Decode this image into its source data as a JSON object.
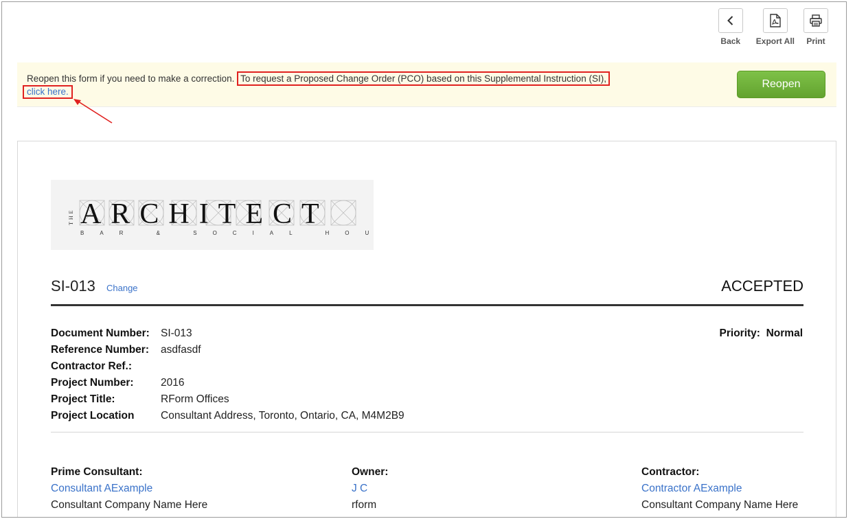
{
  "toolbar": {
    "back_label": "Back",
    "export_label": "Export All",
    "print_label": "Print"
  },
  "notice": {
    "text_part1": "Reopen this form if you need to make a correction.",
    "text_part2": "To request a Proposed Change Order (PCO) based on this Supplemental Instruction (SI),",
    "link_text": "click here.",
    "reopen_label": "Reopen",
    "annotation_color": "#e0211f",
    "reopen_color": "#6cb23a"
  },
  "document": {
    "logo": {
      "text": "ARCHITECT",
      "prefix": "THE",
      "subtitle": "BAR & SOCIAL HOUSE"
    },
    "id": "SI-013",
    "change_label": "Change",
    "status": "ACCEPTED",
    "priority_label": "Priority:",
    "priority_value": "Normal",
    "fields": [
      {
        "label": "Document Number:",
        "value": "SI-013"
      },
      {
        "label": "Reference Number:",
        "value": "asdfasdf"
      },
      {
        "label": "Contractor Ref.:",
        "value": ""
      },
      {
        "label": "Project Number:",
        "value": "2016"
      },
      {
        "label": "Project Title:",
        "value": "RForm Offices"
      },
      {
        "label": "Project Location",
        "value": "Consultant Address, Toronto, Ontario, CA, M4M2B9"
      }
    ],
    "parties": [
      {
        "role": "Prime Consultant:",
        "name": "Consultant AExample",
        "company": "Consultant Company Name Here"
      },
      {
        "role": "Owner:",
        "name": "J C",
        "company": "rform"
      },
      {
        "role": "Contractor:",
        "name": "Contractor AExample",
        "company": "Consultant Company Name Here"
      }
    ]
  },
  "colors": {
    "link": "#3a72c9",
    "notice_bg": "#fefbe6"
  }
}
